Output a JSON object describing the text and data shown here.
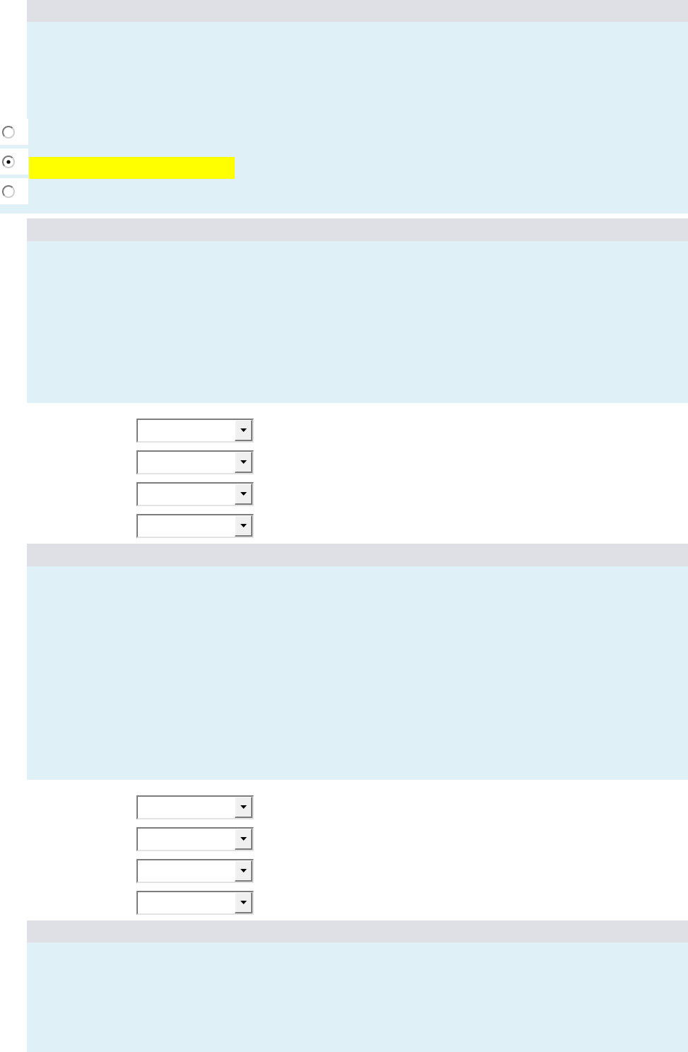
{
  "questions": [
    {
      "kind": "choice",
      "options": [
        {
          "selected": false,
          "highlighted": false
        },
        {
          "selected": true,
          "highlighted": true
        },
        {
          "selected": false,
          "highlighted": false
        }
      ]
    },
    {
      "kind": "dropdowns",
      "dropdowns": [
        {
          "disabled": false
        },
        {
          "disabled": false
        },
        {
          "disabled": false
        },
        {
          "disabled": false
        }
      ]
    },
    {
      "kind": "dropdowns",
      "dropdowns": [
        {
          "disabled": false
        },
        {
          "disabled": false
        },
        {
          "disabled": false
        },
        {
          "disabled": false
        }
      ]
    },
    {
      "kind": "stem"
    }
  ]
}
